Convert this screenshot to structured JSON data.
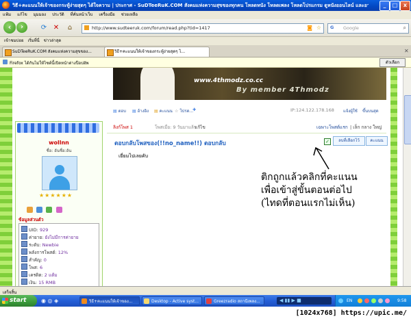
{
  "window": {
    "title": "วิธี+คะแนนให้เจ้าของกระทู้ง่ายสุดๆ ได้ใจความ | ประกาศ - SuDTeeRuK.COM สังคมแห่งความสุขของทุกคน โหลดหนัง โหลดเพลง โหลดโปรแกรม ดูหนังออนไลน์ และอาร์ ...",
    "min": "_",
    "max": "□",
    "close": "x"
  },
  "menu": [
    "แฟ้ม",
    "แก้ไข",
    "มุมมอง",
    "ประวัติ",
    "ที่คั่นหน้าเว็บ",
    "เครื่องมือ",
    "ช่วยเหลือ"
  ],
  "nav": {
    "url": "http://www.sudteeruk.com/forum/read.php?tid=1417",
    "search_placeholder": "Google"
  },
  "bookmarks": [
    "เข้าชมบ่อย",
    "เริ่มที่นี่",
    "ข่าวล่าสุด"
  ],
  "tabs": [
    {
      "label": "SuDTeeRuK.COM สังคมแห่งความสุขของ..."
    },
    {
      "label": "วิธี+คะแนนให้เจ้าของกระทู้ง่ายสุดๆ ไ..."
    }
  ],
  "notification": {
    "text": "Firefox ได้กันไม่ให้ไซต์นี้เปิดหน้าต่างป๊อปอัพ",
    "button": "ตัวเลือก"
  },
  "banner": {
    "site": "www.4thmodz.co.cc",
    "by": "By member 4Thmodz"
  },
  "actions": {
    "reply": "ตอบ",
    "quote": "อ้างอิง",
    "rate": "คะแนน",
    "report": "โปรด...",
    "ip": "IP:124.122.178.168",
    "report_link": "แจ้งผู้ใช้",
    "top": "ขึ้นบนสุด"
  },
  "poster": {
    "name": "wollnn",
    "status": "ชื่อ: อันชื่อ:อัน",
    "rank_stars": "★★★★★★",
    "info_title": "ข้อมูลส่วนตัว",
    "info": [
      {
        "label": "UID:",
        "value": "929"
      },
      {
        "label": "ค่ายาย:",
        "value": "ยังไม่มีการค่ายาย"
      },
      {
        "label": "ระดับ:",
        "value": "Newbie"
      },
      {
        "label": "พลังการโพสต์:",
        "value": "12%"
      },
      {
        "label": "สำคัญ:",
        "value": "0"
      },
      {
        "label": "โพส:",
        "value": "6"
      },
      {
        "label": "เครดิต:",
        "value": "2 แต้ม"
      },
      {
        "label": "เงิน:",
        "value": "15 RMB"
      }
    ]
  },
  "post": {
    "floor": "ลิงก์โพส 1",
    "time": "โพสเมื่อ: 9 วันมาแล้ว",
    "edit": "แก้ไข",
    "view_only": "เฉพาะโพสต์แรก",
    "sizes": "| เล็ก  กลาง  ใหญ่",
    "title": "ตอบกลับโพสของ(!!no_name!!) ตอบกลับ",
    "body": "เยี่ยมไปเลยคับ",
    "check": "✓",
    "rate_selected": "ลบที่เลือกไว้",
    "rate_btn": "คะแนน"
  },
  "annotation": [
    "ติกถูกแล้วคลิกที่คะแนน",
    "เพื่อเข้าสู่ขั้นตอนต่อไป",
    "(ไทดที่ตอนแรกไม่เห็น)"
  ],
  "status": "เสร็จสิ้น",
  "taskbar": {
    "start": "start",
    "tasks": [
      "วิธี+คะแนนให้เจ้าของ...",
      "Desktop - Active syst...",
      "Greezradio สถานีเพลง..."
    ],
    "lang": "EN",
    "clock": "9:58"
  },
  "caption": "[1024x768] https://upic.me/"
}
